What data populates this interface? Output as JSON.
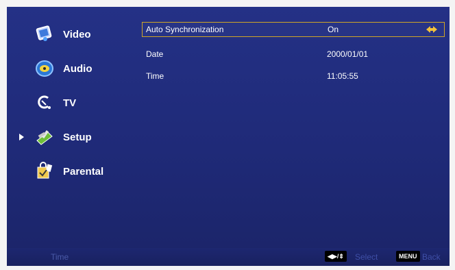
{
  "sidebar": {
    "items": [
      {
        "label": "Video",
        "icon": "video-icon"
      },
      {
        "label": "Audio",
        "icon": "audio-icon"
      },
      {
        "label": "TV",
        "icon": "tv-icon"
      },
      {
        "label": "Setup",
        "icon": "setup-icon",
        "selected": true
      },
      {
        "label": "Parental",
        "icon": "parental-icon"
      }
    ]
  },
  "content": {
    "rows": [
      {
        "label": "Auto Synchronization",
        "value": "On",
        "selected": true
      },
      {
        "label": "Date",
        "value": "2000/01/01"
      },
      {
        "label": "Time",
        "value": "11:05:55"
      }
    ]
  },
  "footer": {
    "title": "Time",
    "nav_key": "◀▶/⇕",
    "select_label": "Select",
    "menu_key": "MENU",
    "back_label": "Back"
  },
  "colors": {
    "background": "#243186",
    "highlight_border": "#d1a626"
  }
}
